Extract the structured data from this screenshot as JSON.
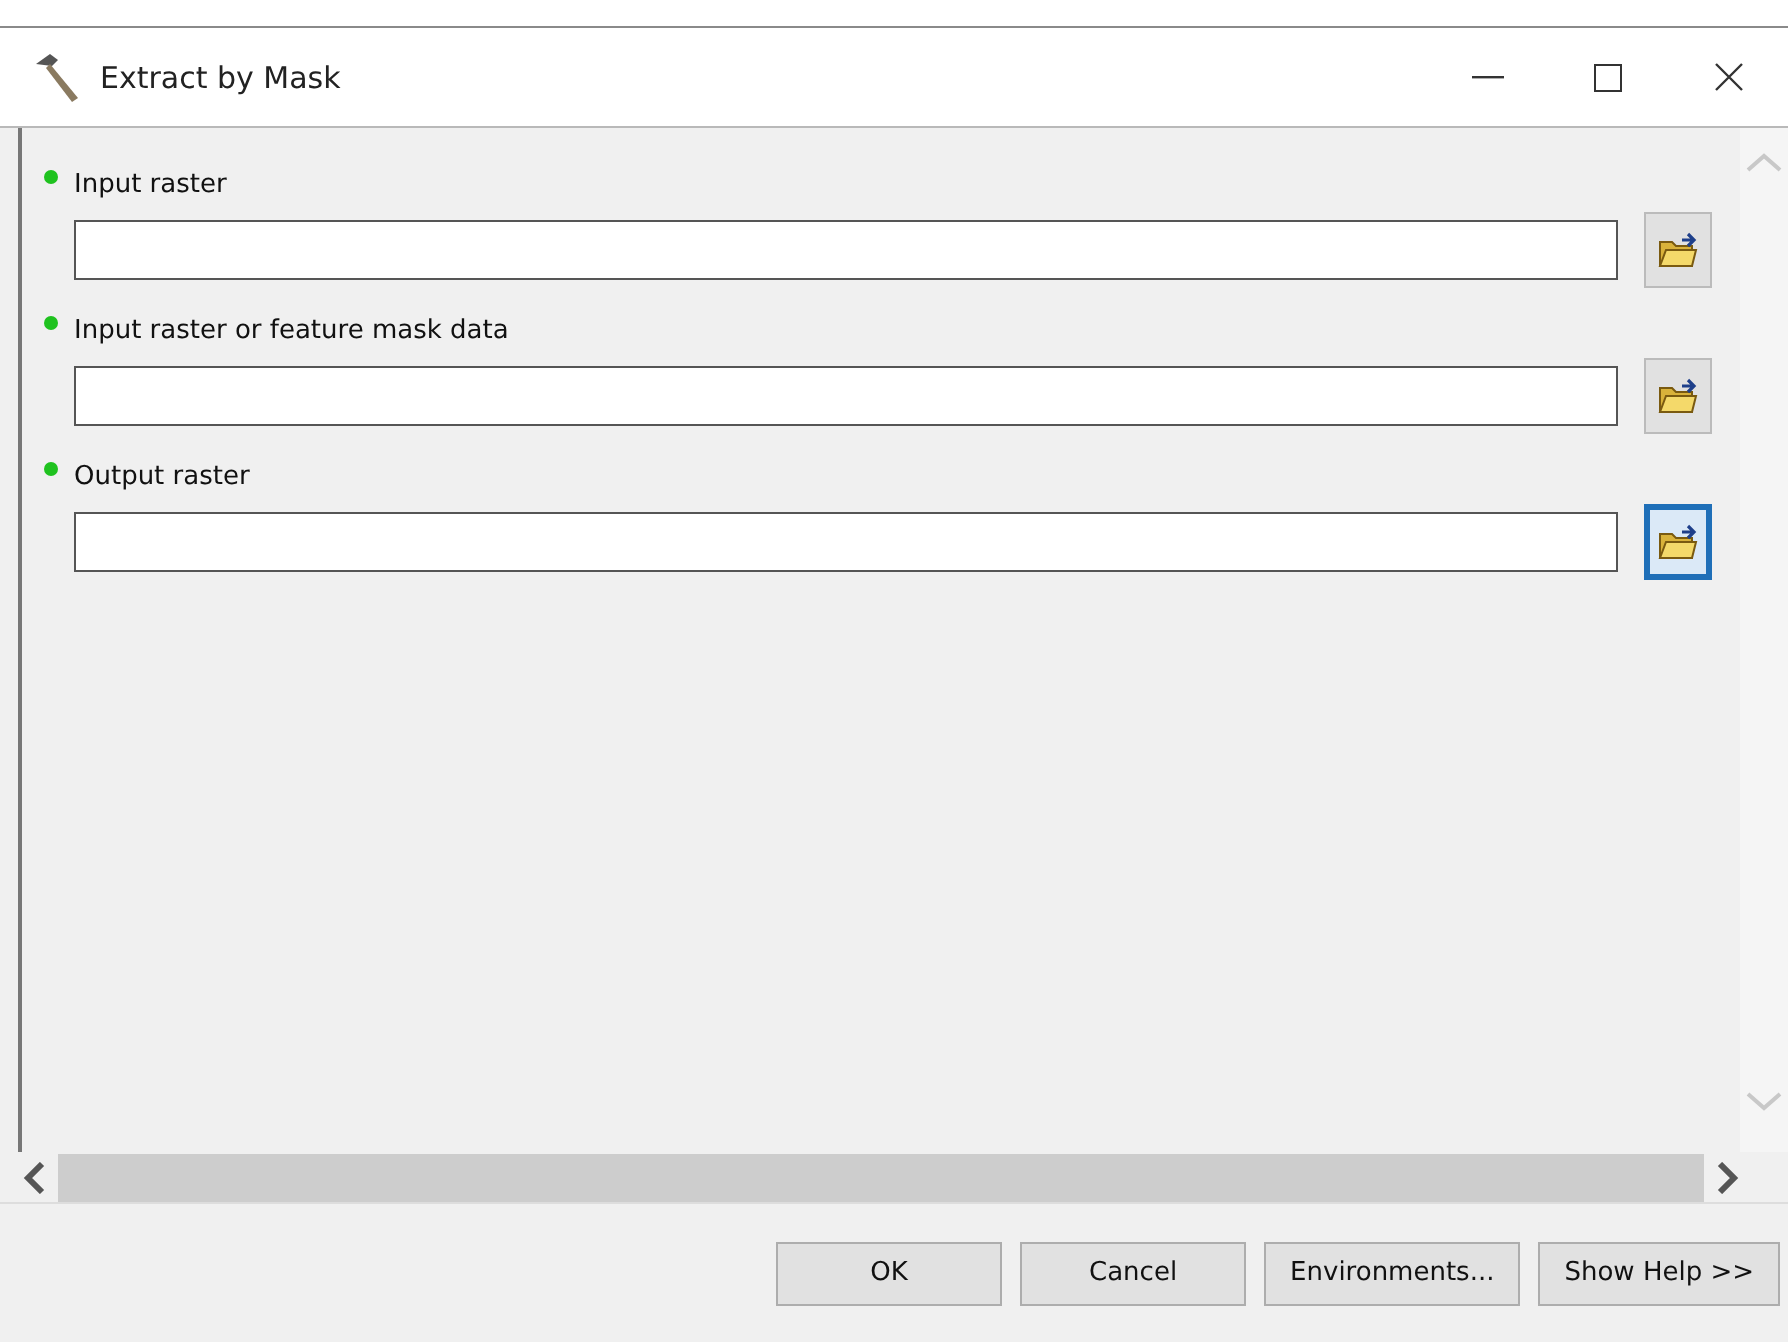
{
  "window": {
    "title": "Extract by Mask"
  },
  "parameters": [
    {
      "label": "Input raster",
      "required": true,
      "browse_focused": false
    },
    {
      "label": "Input raster or feature mask data",
      "required": true,
      "browse_focused": false
    },
    {
      "label": "Output raster",
      "required": true,
      "browse_focused": true
    }
  ],
  "buttons": [
    "OK",
    "Cancel",
    "Environments...",
    "Show Help >>"
  ]
}
